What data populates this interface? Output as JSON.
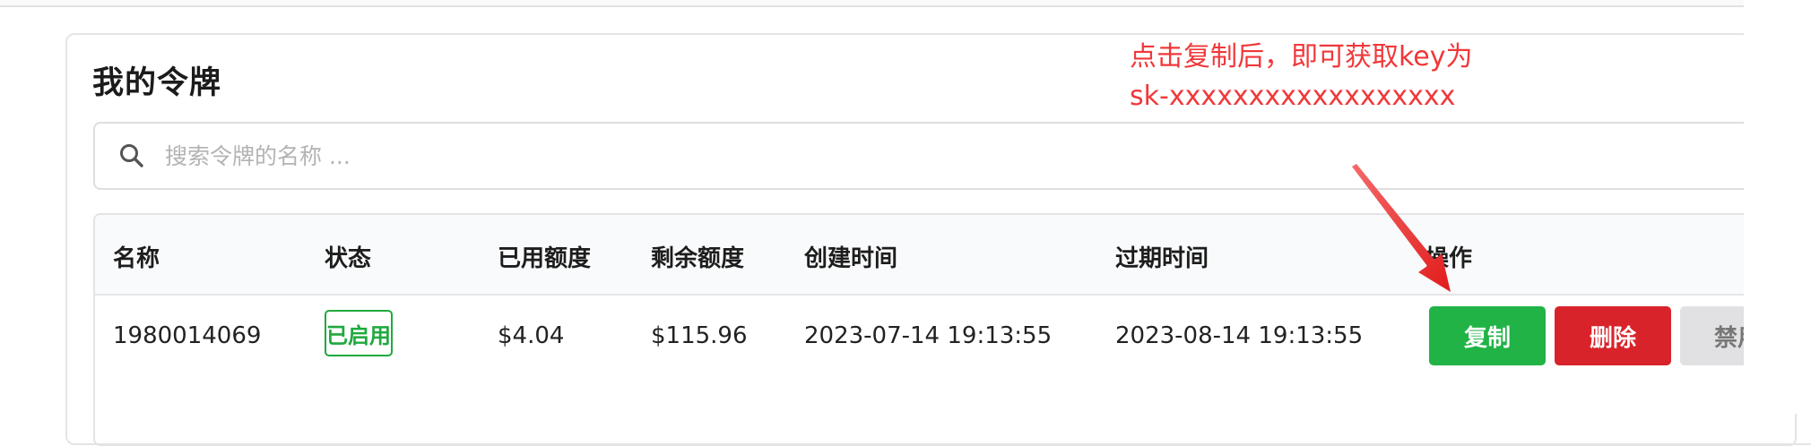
{
  "card": {
    "title": "我的令牌"
  },
  "annotation": {
    "line1": "点击复制后，即可获取key为",
    "line2": "sk-xxxxxxxxxxxxxxxxxx"
  },
  "search": {
    "placeholder": "搜索令牌的名称 ..."
  },
  "table": {
    "columns": [
      "名称",
      "状态",
      "已用额度",
      "剩余额度",
      "创建时间",
      "过期时间",
      "操作"
    ],
    "rows": [
      {
        "name": "1980014069",
        "status": "已启用",
        "used": "$4.04",
        "remaining": "$115.96",
        "created": "2023-07-14 19:13:55",
        "expires": "2023-08-14 19:13:55",
        "actions": {
          "copy": "复制",
          "delete": "删除",
          "disable": "禁用"
        }
      }
    ]
  },
  "colors": {
    "accent_green": "#21b345",
    "danger_red": "#d9232a",
    "annotation_red": "#f0383a",
    "status_green": "#1fa93e"
  },
  "icons": {
    "search": "search-icon"
  }
}
